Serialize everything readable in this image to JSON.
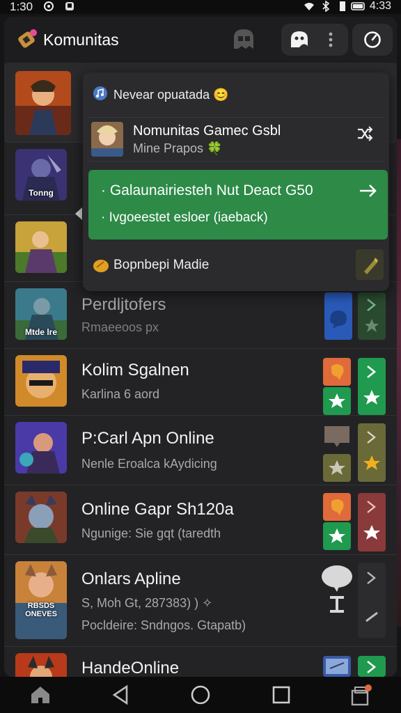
{
  "status": {
    "time": "1:30",
    "battery": "4:33"
  },
  "appbar": {
    "title": "Komunitas"
  },
  "popup": {
    "note": "Nevear opuatada 😊",
    "card_title": "Nomunitas Gamec Gsbl",
    "card_sub": "Mine Prapos 🍀",
    "green_line1": "· Galaunairiesteh Nut Deact G50",
    "green_line2": "· Ivgoeestet esloer (iaeback)",
    "footer": "Bopnbepi Madie"
  },
  "rows": [
    {
      "title": "",
      "sub": ""
    },
    {
      "thumb_label": "Tonng"
    },
    {
      "thumb_label": ""
    },
    {
      "title": "Perdljtofers",
      "sub": "Rmaeeoos px",
      "thumb_label": "Mtde lre"
    },
    {
      "title": "Kolim Sgalnen",
      "sub": "Karlina 6 aord"
    },
    {
      "title": "P:Carl Apn Online",
      "sub": "Nenle Eroalca kAydicing"
    },
    {
      "title": "Online Gapr Sh120a",
      "sub": "Ngunige: Sie gqt (taredth"
    },
    {
      "title": "Onlars Apline",
      "sub": "S, Moh Gt, 287383) ) ✧",
      "sub2": "Pocldeire: Sndngos. Gtapatb)",
      "thumb_label": "RBSDS ONEVES"
    },
    {
      "title": "HandeOnline"
    }
  ],
  "colors": {
    "accent_green": "#2d8a47",
    "orange": "#e06a3a",
    "background": "#151516"
  }
}
